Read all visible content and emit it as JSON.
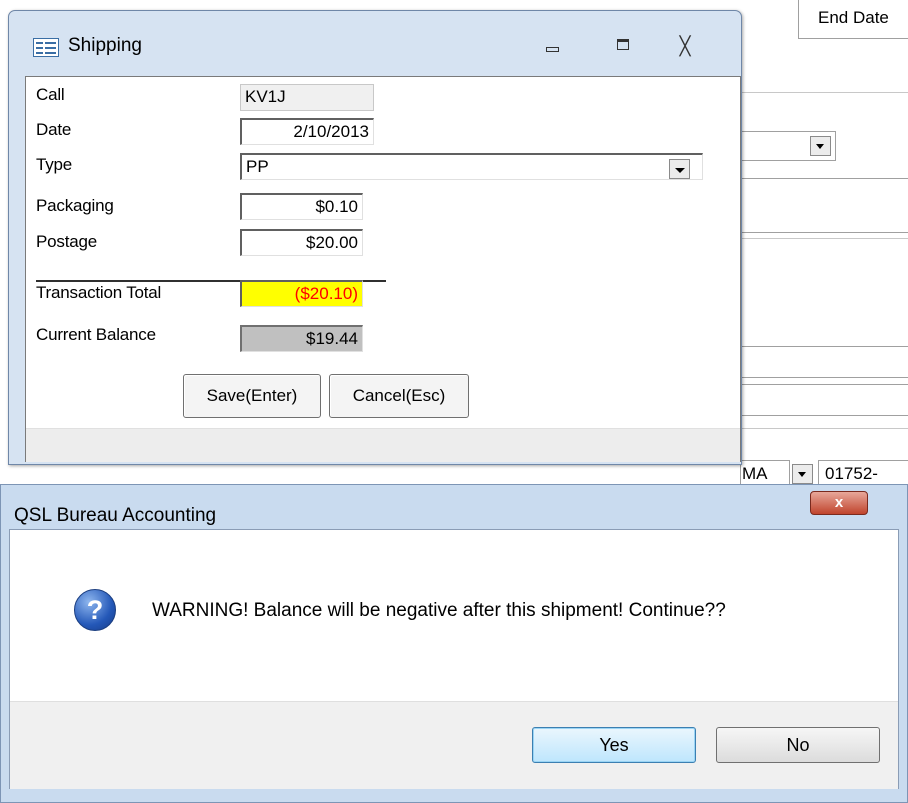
{
  "background": {
    "end_date_label": "End Date",
    "state_value": "MA",
    "zip_value": "01752-"
  },
  "shipping_window": {
    "title": "Shipping",
    "fields": {
      "call": {
        "label": "Call",
        "value": "KV1J"
      },
      "date": {
        "label": "Date",
        "value": "2/10/2013"
      },
      "type": {
        "label": "Type",
        "value": "PP"
      },
      "packaging": {
        "label": "Packaging",
        "value": "$0.10"
      },
      "postage": {
        "label": "Postage",
        "value": "$20.00"
      },
      "transaction_total": {
        "label": "Transaction Total",
        "value": "($20.10)"
      },
      "current_balance": {
        "label": "Current Balance",
        "value": "$19.44"
      }
    },
    "buttons": {
      "save": "Save(Enter)",
      "cancel": "Cancel(Esc)"
    },
    "controls": {
      "close_glyph": "╳"
    }
  },
  "dialog": {
    "title": "QSL Bureau Accounting",
    "close_glyph": "x",
    "icon_glyph": "?",
    "message": "WARNING! Balance will be negative after this shipment! Continue??",
    "buttons": {
      "yes": "Yes",
      "no": "No"
    }
  },
  "colors": {
    "total_bg": "#ffff00",
    "total_text": "#ff0000",
    "dialog_frame": "#c9dbef"
  }
}
